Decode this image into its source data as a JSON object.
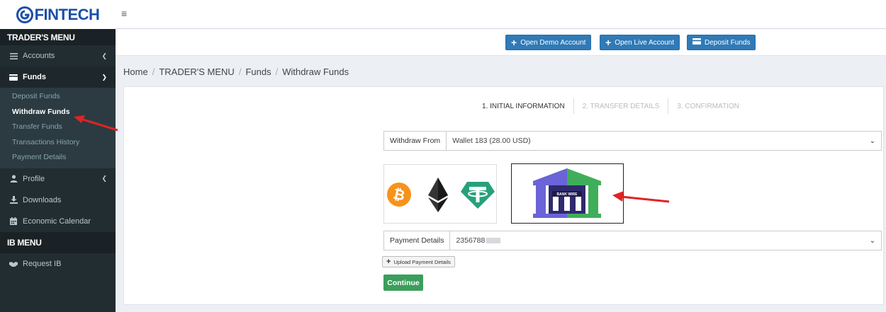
{
  "brand": {
    "name": "FINTECH",
    "accent": "#1b4fa8"
  },
  "sidebar": {
    "traders_header": "TRADER'S MENU",
    "accounts": {
      "label": "Accounts",
      "icon": "list-icon"
    },
    "funds": {
      "label": "Funds",
      "icon": "wallet-icon"
    },
    "funds_submenu": [
      "Deposit Funds",
      "Withdraw Funds",
      "Transfer Funds",
      "Transactions History",
      "Payment Details"
    ],
    "profile": {
      "label": "Profile",
      "icon": "user-icon"
    },
    "downloads": {
      "label": "Downloads",
      "icon": "download-icon"
    },
    "calendar": {
      "label": "Economic Calendar",
      "icon": "calendar-icon"
    },
    "ib_header": "IB MENU",
    "request_ib": {
      "label": "Request IB",
      "icon": "handshake-icon"
    }
  },
  "actions": {
    "open_demo": "Open Demo Account",
    "open_live": "Open Live Account",
    "deposit": "Deposit Funds"
  },
  "breadcrumb": [
    "Home",
    "TRADER'S MENU",
    "Funds",
    "Withdraw Funds"
  ],
  "steps": [
    "1. INITIAL INFORMATION",
    "2. TRANSFER DETAILS",
    "3. CONFIRMATION"
  ],
  "form": {
    "withdraw_from_label": "Withdraw From",
    "withdraw_from_value": "Wallet 183 (28.00 USD)",
    "payment_details_label": "Payment Details",
    "payment_details_value": "2356788",
    "bank_label": "BANK WIRE",
    "upload_label": "Upload Payment Details",
    "continue_label": "Continue"
  },
  "colors": {
    "primary": "#2f7ab7",
    "success": "#3c9e5c",
    "sidebar": "#222d32",
    "annotation": "#e02424"
  }
}
